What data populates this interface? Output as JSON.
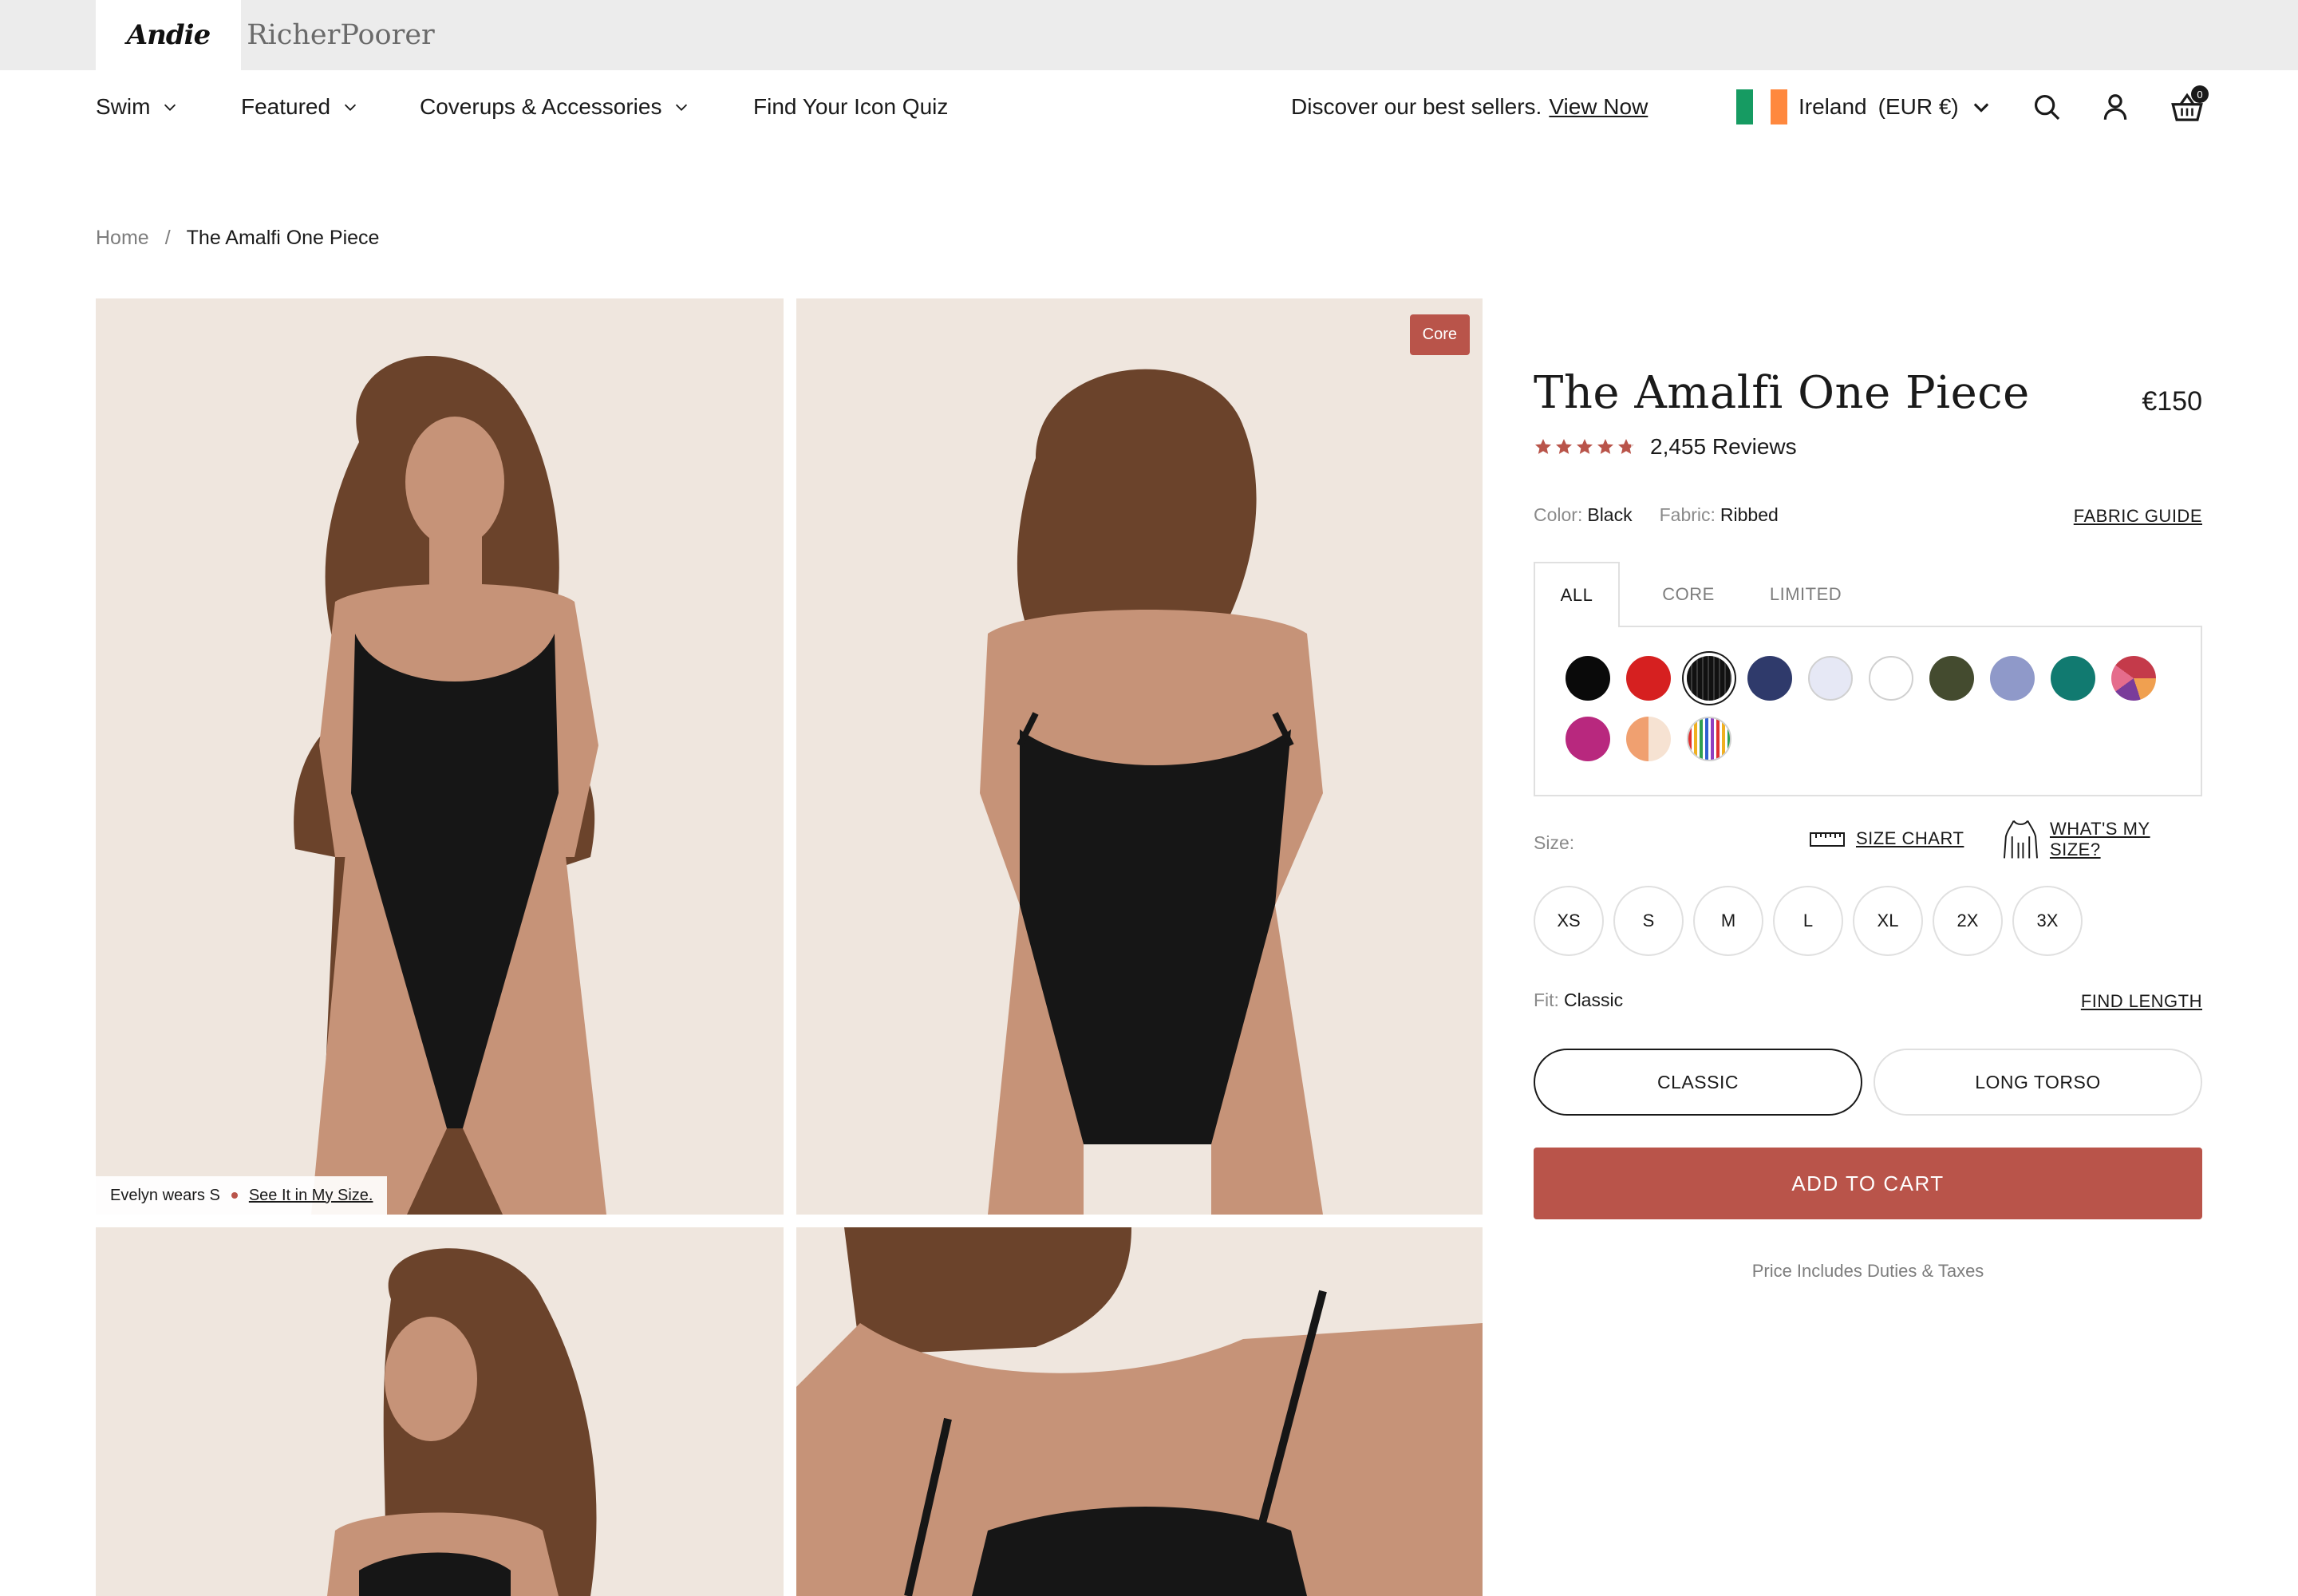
{
  "brands": {
    "primary": "Andie",
    "secondary": "RicherPoorer"
  },
  "nav": {
    "items": [
      {
        "label": "Swim",
        "has_menu": true
      },
      {
        "label": "Featured",
        "has_menu": true
      },
      {
        "label": "Coverups & Accessories",
        "has_menu": true
      },
      {
        "label": "Find Your Icon Quiz",
        "has_menu": false
      }
    ],
    "promo_text": "Discover our best sellers.",
    "promo_link": "View Now",
    "country": "Ireland",
    "currency": "(EUR €)",
    "cart_count": "0",
    "icons": [
      "search-icon",
      "account-icon",
      "cart-icon"
    ]
  },
  "breadcrumb": {
    "home": "Home",
    "separator": "/",
    "current": "The Amalfi One Piece"
  },
  "gallery": {
    "badge": "Core",
    "model_note": "Evelyn wears S",
    "model_link": "See It in My Size."
  },
  "product": {
    "title": "The Amalfi One Piece",
    "price": "€150",
    "rating": 4.8,
    "reviews": "2,455 Reviews",
    "color_label": "Color:",
    "color_value": "Black",
    "fabric_label": "Fabric:",
    "fabric_value": "Ribbed",
    "fabric_guide": "FABRIC GUIDE",
    "tabs": [
      "ALL",
      "CORE",
      "LIMITED"
    ],
    "swatches": [
      {
        "name": "black",
        "color": "#0a0a0a"
      },
      {
        "name": "red",
        "color": "#d62020"
      },
      {
        "name": "black-ribbed",
        "color": "#1a1a1a",
        "selected": true
      },
      {
        "name": "navy",
        "color": "#2f3a6b"
      },
      {
        "name": "pale-lavender",
        "color": "#e6e8f5"
      },
      {
        "name": "white",
        "color": "#ffffff"
      },
      {
        "name": "olive",
        "color": "#444b2f"
      },
      {
        "name": "periwinkle",
        "color": "#8f99c9"
      },
      {
        "name": "teal",
        "color": "#117a70"
      },
      {
        "name": "abstract-print",
        "color": "#c43a4a"
      },
      {
        "name": "magenta",
        "color": "#b8287e"
      },
      {
        "name": "peach-colorblock",
        "color": "#f0a070"
      },
      {
        "name": "rainbow-stripe",
        "color": "#ffffff"
      }
    ],
    "size_label": "Size:",
    "size_chart": "SIZE CHART",
    "whats_my_size": "WHAT'S MY SIZE?",
    "sizes": [
      "XS",
      "S",
      "M",
      "L",
      "XL",
      "2X",
      "3X"
    ],
    "fit_label": "Fit:",
    "fit_value": "Classic",
    "find_length": "FIND LENGTH",
    "fit_options": [
      "CLASSIC",
      "LONG TORSO"
    ],
    "add_to_cart": "ADD TO CART",
    "duties_note": "Price Includes Duties & Taxes"
  },
  "colors": {
    "accent": "#b9544a",
    "text": "#1a1a1a",
    "muted": "#7d7d7d",
    "border": "#e0e0e0",
    "brandbar": "#ececec"
  }
}
